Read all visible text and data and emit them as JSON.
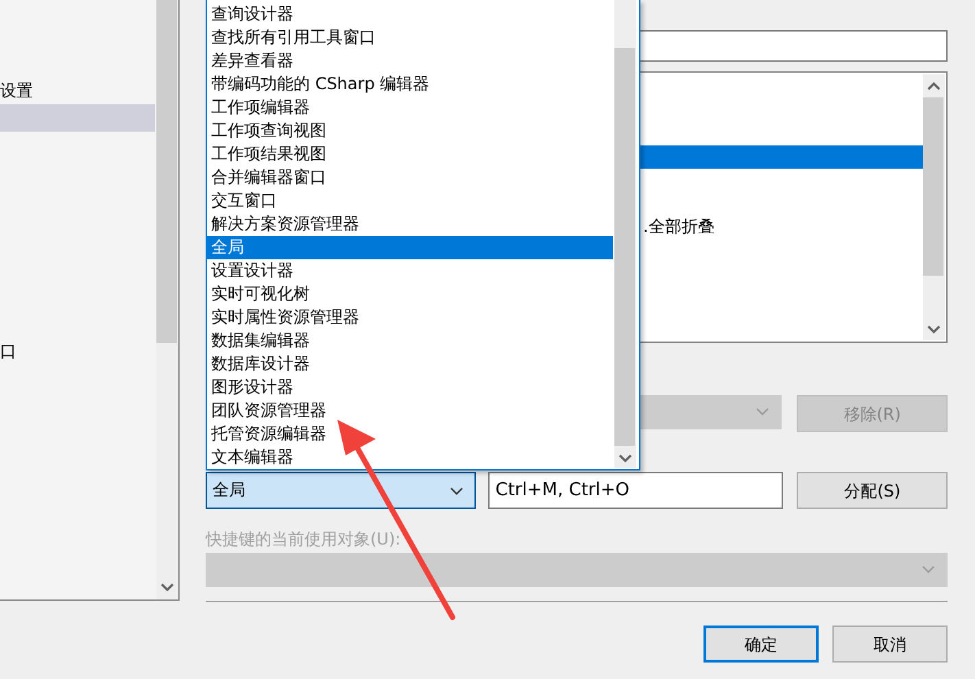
{
  "left_panel": {
    "items": [
      {
        "label": "设置",
        "selected": false
      },
      {
        "selected": true
      },
      {
        "label": "口",
        "selected": false
      }
    ]
  },
  "command_listbox": {
    "rows": [
      {
        "selected": false
      },
      {
        "selected": false
      },
      {
        "selected": false
      },
      {
        "selected": true
      },
      {
        "selected": false
      },
      {
        "selected": false
      },
      {
        "text": ".全部折叠",
        "selected": false
      }
    ]
  },
  "existing_shortcut": {
    "disabled": true,
    "remove_button": {
      "label": "移除(R)",
      "disabled": true
    }
  },
  "new_shortcut": {
    "scope_combo": {
      "value": "全局",
      "open": true,
      "options": [
        {
          "label": "查询设计器",
          "selected": false
        },
        {
          "label": "查找所有引用工具窗口",
          "selected": false
        },
        {
          "label": "差异查看器",
          "selected": false
        },
        {
          "label": "带编码功能的 CSharp 编辑器",
          "selected": false
        },
        {
          "label": "工作项编辑器",
          "selected": false
        },
        {
          "label": "工作项查询视图",
          "selected": false
        },
        {
          "label": "工作项结果视图",
          "selected": false
        },
        {
          "label": "合并编辑器窗口",
          "selected": false
        },
        {
          "label": "交互窗口",
          "selected": false
        },
        {
          "label": "解决方案资源管理器",
          "selected": false
        },
        {
          "label": "全局",
          "selected": true
        },
        {
          "label": "设置设计器",
          "selected": false
        },
        {
          "label": "实时可视化树",
          "selected": false
        },
        {
          "label": "实时属性资源管理器",
          "selected": false
        },
        {
          "label": "数据集编辑器",
          "selected": false
        },
        {
          "label": "数据库设计器",
          "selected": false
        },
        {
          "label": "图形设计器",
          "selected": false
        },
        {
          "label": "团队资源管理器",
          "selected": false
        },
        {
          "label": "托管资源编辑器",
          "selected": false
        },
        {
          "label": "文本编辑器",
          "selected": false
        }
      ]
    },
    "keys_value": "Ctrl+M, Ctrl+O",
    "assign_button": "分配(S)"
  },
  "used_by": {
    "label": "快捷键的当前使用对象(U):",
    "disabled": true
  },
  "buttons": [
    {
      "label": "确定",
      "default": true
    },
    {
      "label": "取消",
      "default": false
    }
  ]
}
